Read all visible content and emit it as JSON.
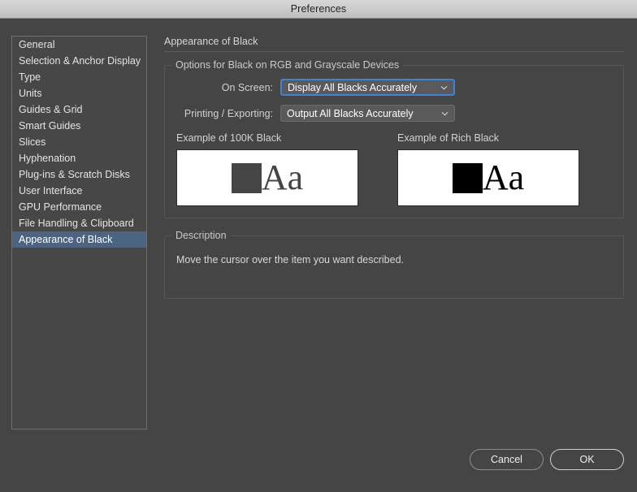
{
  "window": {
    "title": "Preferences"
  },
  "sidebar": {
    "items": [
      {
        "label": "General",
        "selected": false
      },
      {
        "label": "Selection & Anchor Display",
        "selected": false
      },
      {
        "label": "Type",
        "selected": false
      },
      {
        "label": "Units",
        "selected": false
      },
      {
        "label": "Guides & Grid",
        "selected": false
      },
      {
        "label": "Smart Guides",
        "selected": false
      },
      {
        "label": "Slices",
        "selected": false
      },
      {
        "label": "Hyphenation",
        "selected": false
      },
      {
        "label": "Plug-ins & Scratch Disks",
        "selected": false
      },
      {
        "label": "User Interface",
        "selected": false
      },
      {
        "label": "GPU Performance",
        "selected": false
      },
      {
        "label": "File Handling & Clipboard",
        "selected": false
      },
      {
        "label": "Appearance of Black",
        "selected": true
      }
    ]
  },
  "main": {
    "panel_title": "Appearance of Black",
    "options_group": {
      "label": "Options for Black on RGB and Grayscale Devices",
      "fields": [
        {
          "label": "On Screen:",
          "value": "Display All Blacks Accurately",
          "focused": true,
          "icon": "chevron-down-icon"
        },
        {
          "label": "Printing / Exporting:",
          "value": "Output All Blacks Accurately",
          "focused": false,
          "icon": "chevron-down-icon"
        }
      ],
      "examples": [
        {
          "caption": "Example of 100K Black",
          "sample_text": "Aa",
          "swatch_color": "#454545"
        },
        {
          "caption": "Example of Rich Black",
          "sample_text": "Aa",
          "swatch_color": "#000000"
        }
      ]
    },
    "description_group": {
      "label": "Description",
      "text": "Move the cursor over the item you want described."
    }
  },
  "footer": {
    "cancel_label": "Cancel",
    "ok_label": "OK"
  },
  "colors": {
    "window_bg": "#454545",
    "titlebar_bg": "#cccccc",
    "selection_blue": "#4c6484",
    "focus_blue": "#3d83d6"
  }
}
